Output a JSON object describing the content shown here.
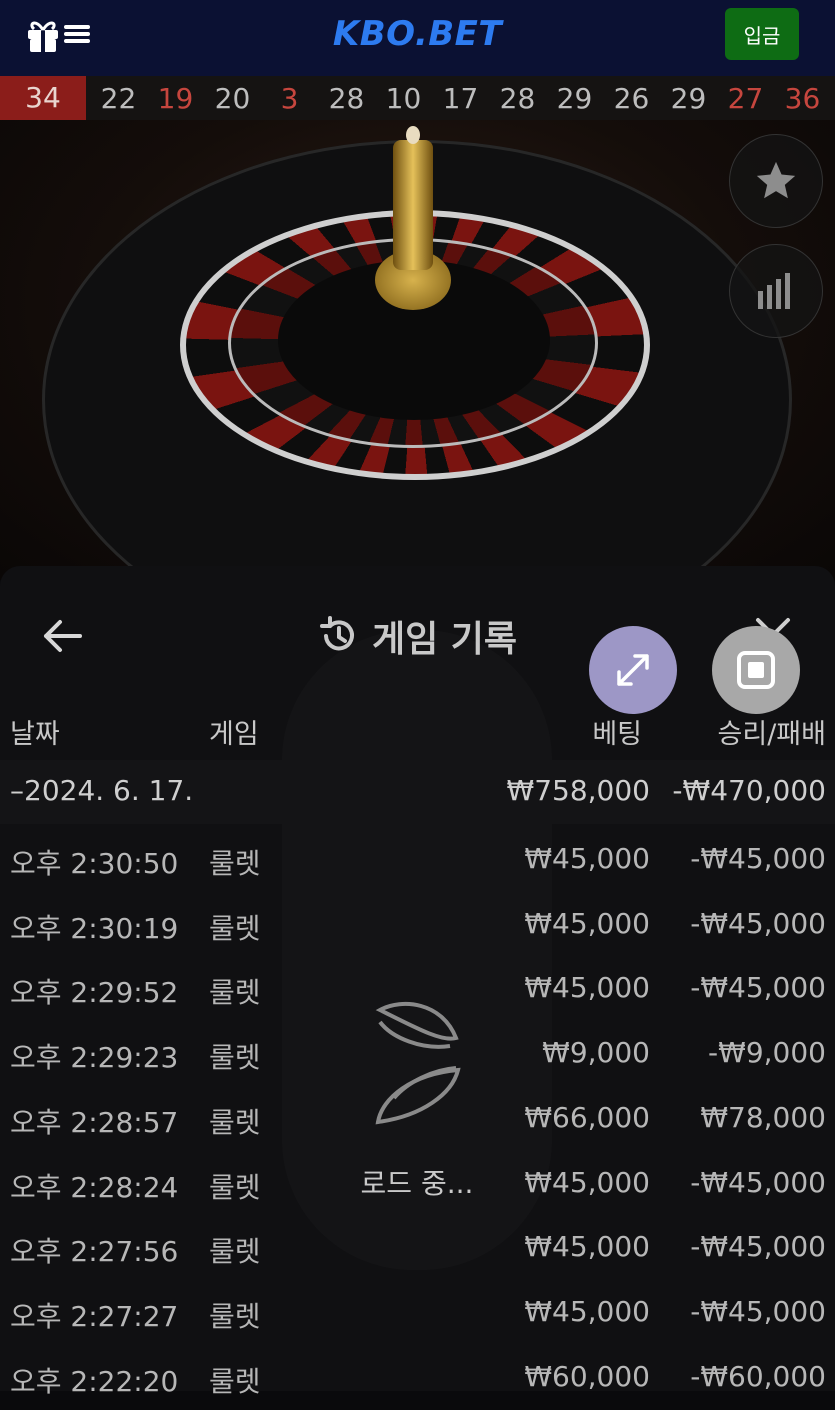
{
  "header": {
    "logo": "KBO.BET",
    "deposit_label": "입금"
  },
  "recent_numbers": [
    {
      "value": "34",
      "color": "red"
    },
    {
      "value": "22",
      "color": "black"
    },
    {
      "value": "19",
      "color": "red"
    },
    {
      "value": "20",
      "color": "black"
    },
    {
      "value": "3",
      "color": "red"
    },
    {
      "value": "28",
      "color": "black"
    },
    {
      "value": "10",
      "color": "black"
    },
    {
      "value": "17",
      "color": "black"
    },
    {
      "value": "28",
      "color": "black"
    },
    {
      "value": "29",
      "color": "black"
    },
    {
      "value": "26",
      "color": "black"
    },
    {
      "value": "29",
      "color": "black"
    },
    {
      "value": "27",
      "color": "red"
    },
    {
      "value": "36",
      "color": "red"
    }
  ],
  "colors": {
    "red_number": "#c6463e",
    "black_number": "#bdbdbd",
    "first_cell_bg": "#8b1d1a",
    "deposit_bg": "#0e6c14",
    "logo": "#2d7bf0"
  },
  "panel": {
    "title": "게임 기록",
    "columns": {
      "date": "날짜",
      "game": "게임",
      "bet": "베팅",
      "result": "승리/패배"
    },
    "date_group": {
      "date": "–2024. 6. 17.",
      "bet": "₩758,000",
      "result": "-₩470,000"
    },
    "rows": [
      {
        "time": "오후 2:30:50",
        "game": "룰렛",
        "bet": "₩45,000",
        "result": "-₩45,000"
      },
      {
        "time": "오후 2:30:19",
        "game": "룰렛",
        "bet": "₩45,000",
        "result": "-₩45,000"
      },
      {
        "time": "오후 2:29:52",
        "game": "룰렛",
        "bet": "₩45,000",
        "result": "-₩45,000"
      },
      {
        "time": "오후 2:29:23",
        "game": "룰렛",
        "bet": "₩9,000",
        "result": "-₩9,000"
      },
      {
        "time": "오후 2:28:57",
        "game": "룰렛",
        "bet": "₩66,000",
        "result": "₩78,000"
      },
      {
        "time": "오후 2:28:24",
        "game": "룰렛",
        "bet": "₩45,000",
        "result": "-₩45,000"
      },
      {
        "time": "오후 2:27:56",
        "game": "룰렛",
        "bet": "₩45,000",
        "result": "-₩45,000"
      },
      {
        "time": "오후 2:27:27",
        "game": "룰렛",
        "bet": "₩45,000",
        "result": "-₩45,000"
      },
      {
        "time": "오후 2:22:20",
        "game": "룰렛",
        "bet": "₩60,000",
        "result": "-₩60,000"
      }
    ],
    "loading_text": "로드 중..."
  },
  "icons": [
    "gift-icon",
    "menu-icon",
    "star-icon",
    "stats-icon",
    "back-arrow-icon",
    "history-icon",
    "close-icon",
    "expand-icon",
    "stop-icon",
    "loading-spinner-icon"
  ]
}
